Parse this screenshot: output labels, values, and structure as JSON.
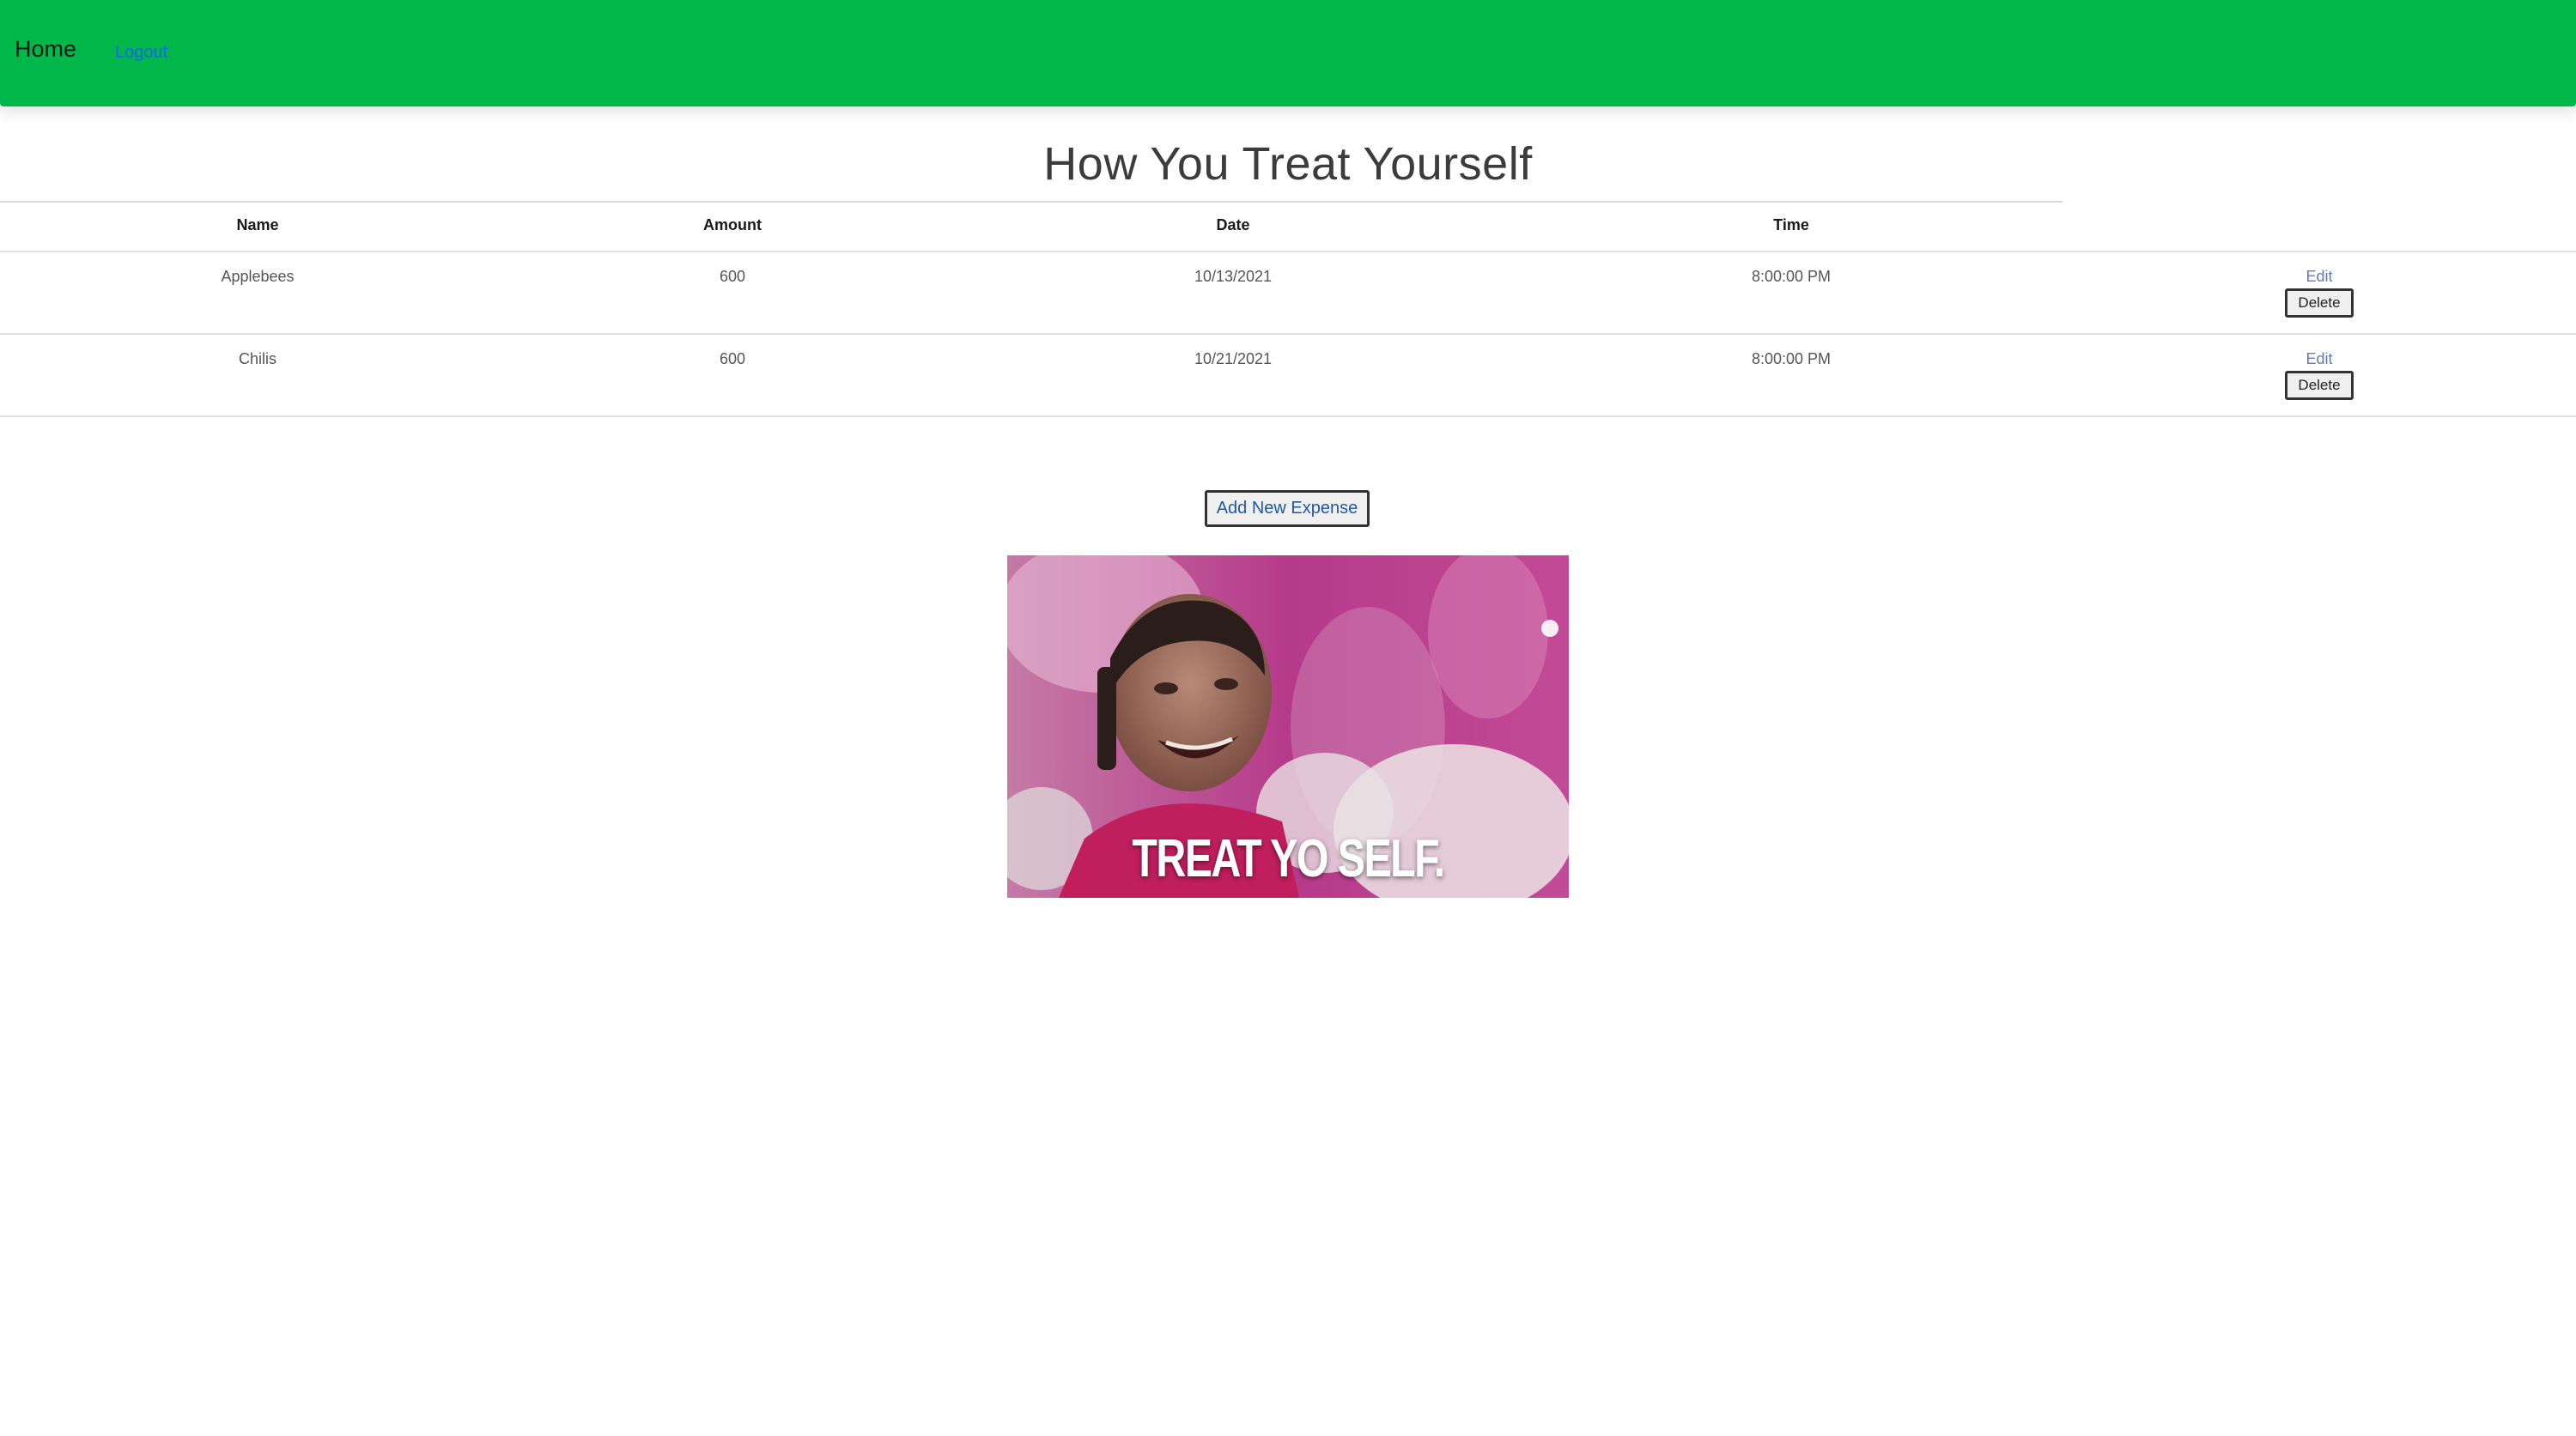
{
  "nav": {
    "home_label": "Home",
    "logout_label": "Logout"
  },
  "page": {
    "title": "How You Treat Yourself"
  },
  "table": {
    "columns": [
      "Name",
      "Amount",
      "Date",
      "Time"
    ],
    "rows": [
      {
        "name": "Applebees",
        "amount": "600",
        "date": "10/13/2021",
        "time": "8:00:00 PM",
        "edit_label": "Edit",
        "delete_label": "Delete"
      },
      {
        "name": "Chilis",
        "amount": "600",
        "date": "10/21/2021",
        "time": "8:00:00 PM",
        "edit_label": "Edit",
        "delete_label": "Delete"
      }
    ]
  },
  "actions": {
    "add_label": "Add New Expense"
  },
  "gif": {
    "caption": "TREAT YO SELF."
  },
  "colors": {
    "navbar": "#00b74a",
    "link": "#1266f1",
    "title": "#3c3c3c"
  }
}
